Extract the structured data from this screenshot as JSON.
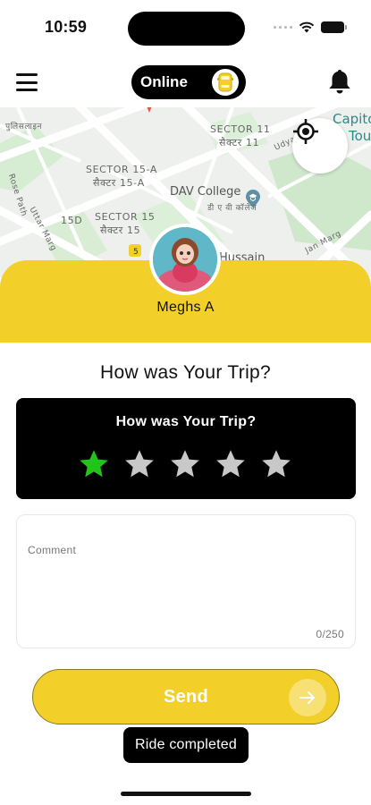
{
  "status_bar": {
    "time": "10:59"
  },
  "top_bar": {
    "status_toggle_label": "Online",
    "icons": [
      "menu-icon",
      "car-icon",
      "bell-icon"
    ]
  },
  "map": {
    "labels": {
      "place_top_left": "पुलिसलाइन",
      "sector_11": "SECTOR 11",
      "sector_11_hi": "सैक्टर 11",
      "capitol": "Capitol",
      "tour": "Tour",
      "sector_15a": "SECTOR 15-A",
      "sector_15a_hi": "सैक्टर 15-A",
      "dav_college": "DAV College",
      "dav_hi": "डी ए वी कॉलेज",
      "sector_15": "SECTOR 15",
      "sector_15_hi": "सैक्टर 15",
      "sector_15d": "15D",
      "road_5": "5",
      "hussain": "Hussain",
      "udyan_path": "Udyan Path",
      "jan_marg": "Jan Marg",
      "uttar_marg": "Uttar Marg",
      "road_left": "Rose Path"
    },
    "icons": [
      "locate-icon",
      "location-pin-icon",
      "school-icon"
    ]
  },
  "driver": {
    "name": "Meghs A"
  },
  "feedback": {
    "heading": "How was Your Trip?",
    "card_title": "How was Your Trip?",
    "rating": 1,
    "max_rating": 5,
    "comment_placeholder": "Comment",
    "comment_counter": "0/250",
    "send_label": "Send"
  },
  "toast": {
    "message": "Ride completed"
  },
  "colors": {
    "accent_yellow": "#f3cf2a",
    "star_active": "#22c41a",
    "star_inactive": "#c8c8c8",
    "card_bg": "#000000"
  }
}
